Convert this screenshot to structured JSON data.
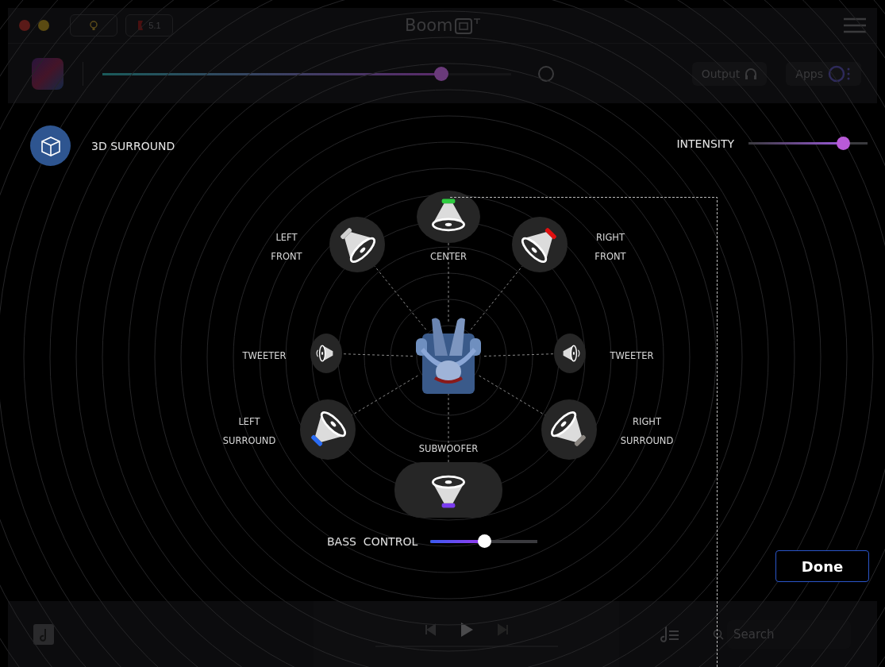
{
  "header": {
    "badge": "5.1",
    "title": "Boom",
    "volume": {
      "level": 0.83
    },
    "output_button": "Output",
    "apps_button": "Apps"
  },
  "surround": {
    "title": "3D SURROUND",
    "intensity_label": "INTENSITY",
    "intensity": {
      "level": 0.79
    }
  },
  "speakers": [
    {
      "kind": "front",
      "label": "LEFT FRONT",
      "color": "#d0d0d0"
    },
    {
      "kind": "front",
      "label": "CENTER",
      "color": "#2ecc40"
    },
    {
      "kind": "front",
      "label": "RIGHT FRONT",
      "color": "#e01010"
    },
    {
      "kind": "tweeter",
      "label": "TWEETER"
    },
    {
      "kind": "tweeter",
      "label": "TWEETER"
    },
    {
      "kind": "surround",
      "label": "LEFT SURROUND",
      "color": "#2a6cf5"
    },
    {
      "kind": "surround",
      "label": "RIGHT SURROUND",
      "color": "#8a8580"
    },
    {
      "kind": "sub",
      "label": "SUBWOOFER",
      "color": "#7b3cf0"
    }
  ],
  "bass": {
    "label": "BASS  CONTROL",
    "level": 0.5
  },
  "done_button": "Done",
  "player": {
    "progress": {
      "level": 0
    },
    "search_placeholder": "Search"
  }
}
